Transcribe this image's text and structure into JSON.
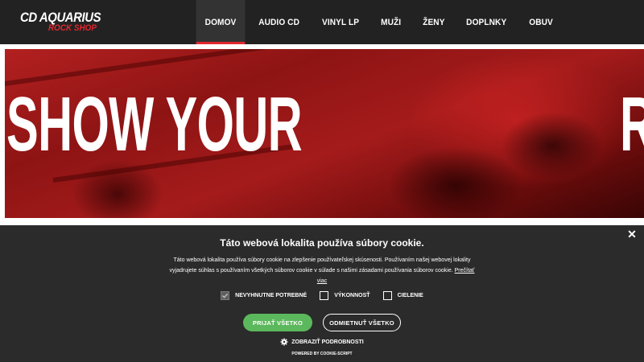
{
  "logo": {
    "main": "CD AQUARIUS",
    "sub": "ROCK SHOP"
  },
  "nav": {
    "items": [
      {
        "label": "DOMOV",
        "active": true
      },
      {
        "label": "AUDIO CD"
      },
      {
        "label": "VINYL LP"
      },
      {
        "label": "MUŽI"
      },
      {
        "label": "ŽENY"
      },
      {
        "label": "DOPLNKY"
      },
      {
        "label": "OBUV"
      }
    ]
  },
  "hero": {
    "text_left": "SHOW YOUR",
    "text_right": "R"
  },
  "cookie": {
    "close_icon": "close-icon",
    "title": "Táto webová lokalita používa súbory cookie.",
    "body": "Táto webová lokalita používa súbory cookie na zlepšenie používateľskej skúsenosti. Používaním našej webovej lokality vyjadrujete súhlas s používaním všetkých súborov cookie v súlade s našimi zásadami používania súborov cookie.",
    "read_more": "Prečítať viac",
    "checkboxes": [
      {
        "label": "NEVYHNUTNE POTREBNÉ",
        "checked": true
      },
      {
        "label": "VÝKONNOSŤ",
        "checked": false
      },
      {
        "label": "CIELENIE",
        "checked": false
      }
    ],
    "accept_label": "PRIJAŤ VŠETKO",
    "decline_label": "ODMIETNUŤ VŠETKO",
    "details_label": "ZOBRAZIŤ PODROBNOSTI",
    "details_icon": "gear-icon",
    "powered_by": "POWERED BY COOKIE-SCRIPT"
  },
  "colors": {
    "header_bg": "#222222",
    "accent_red": "#e3262e",
    "accept_green": "#5cb85c",
    "cookie_bg": "#2b2b2b"
  }
}
